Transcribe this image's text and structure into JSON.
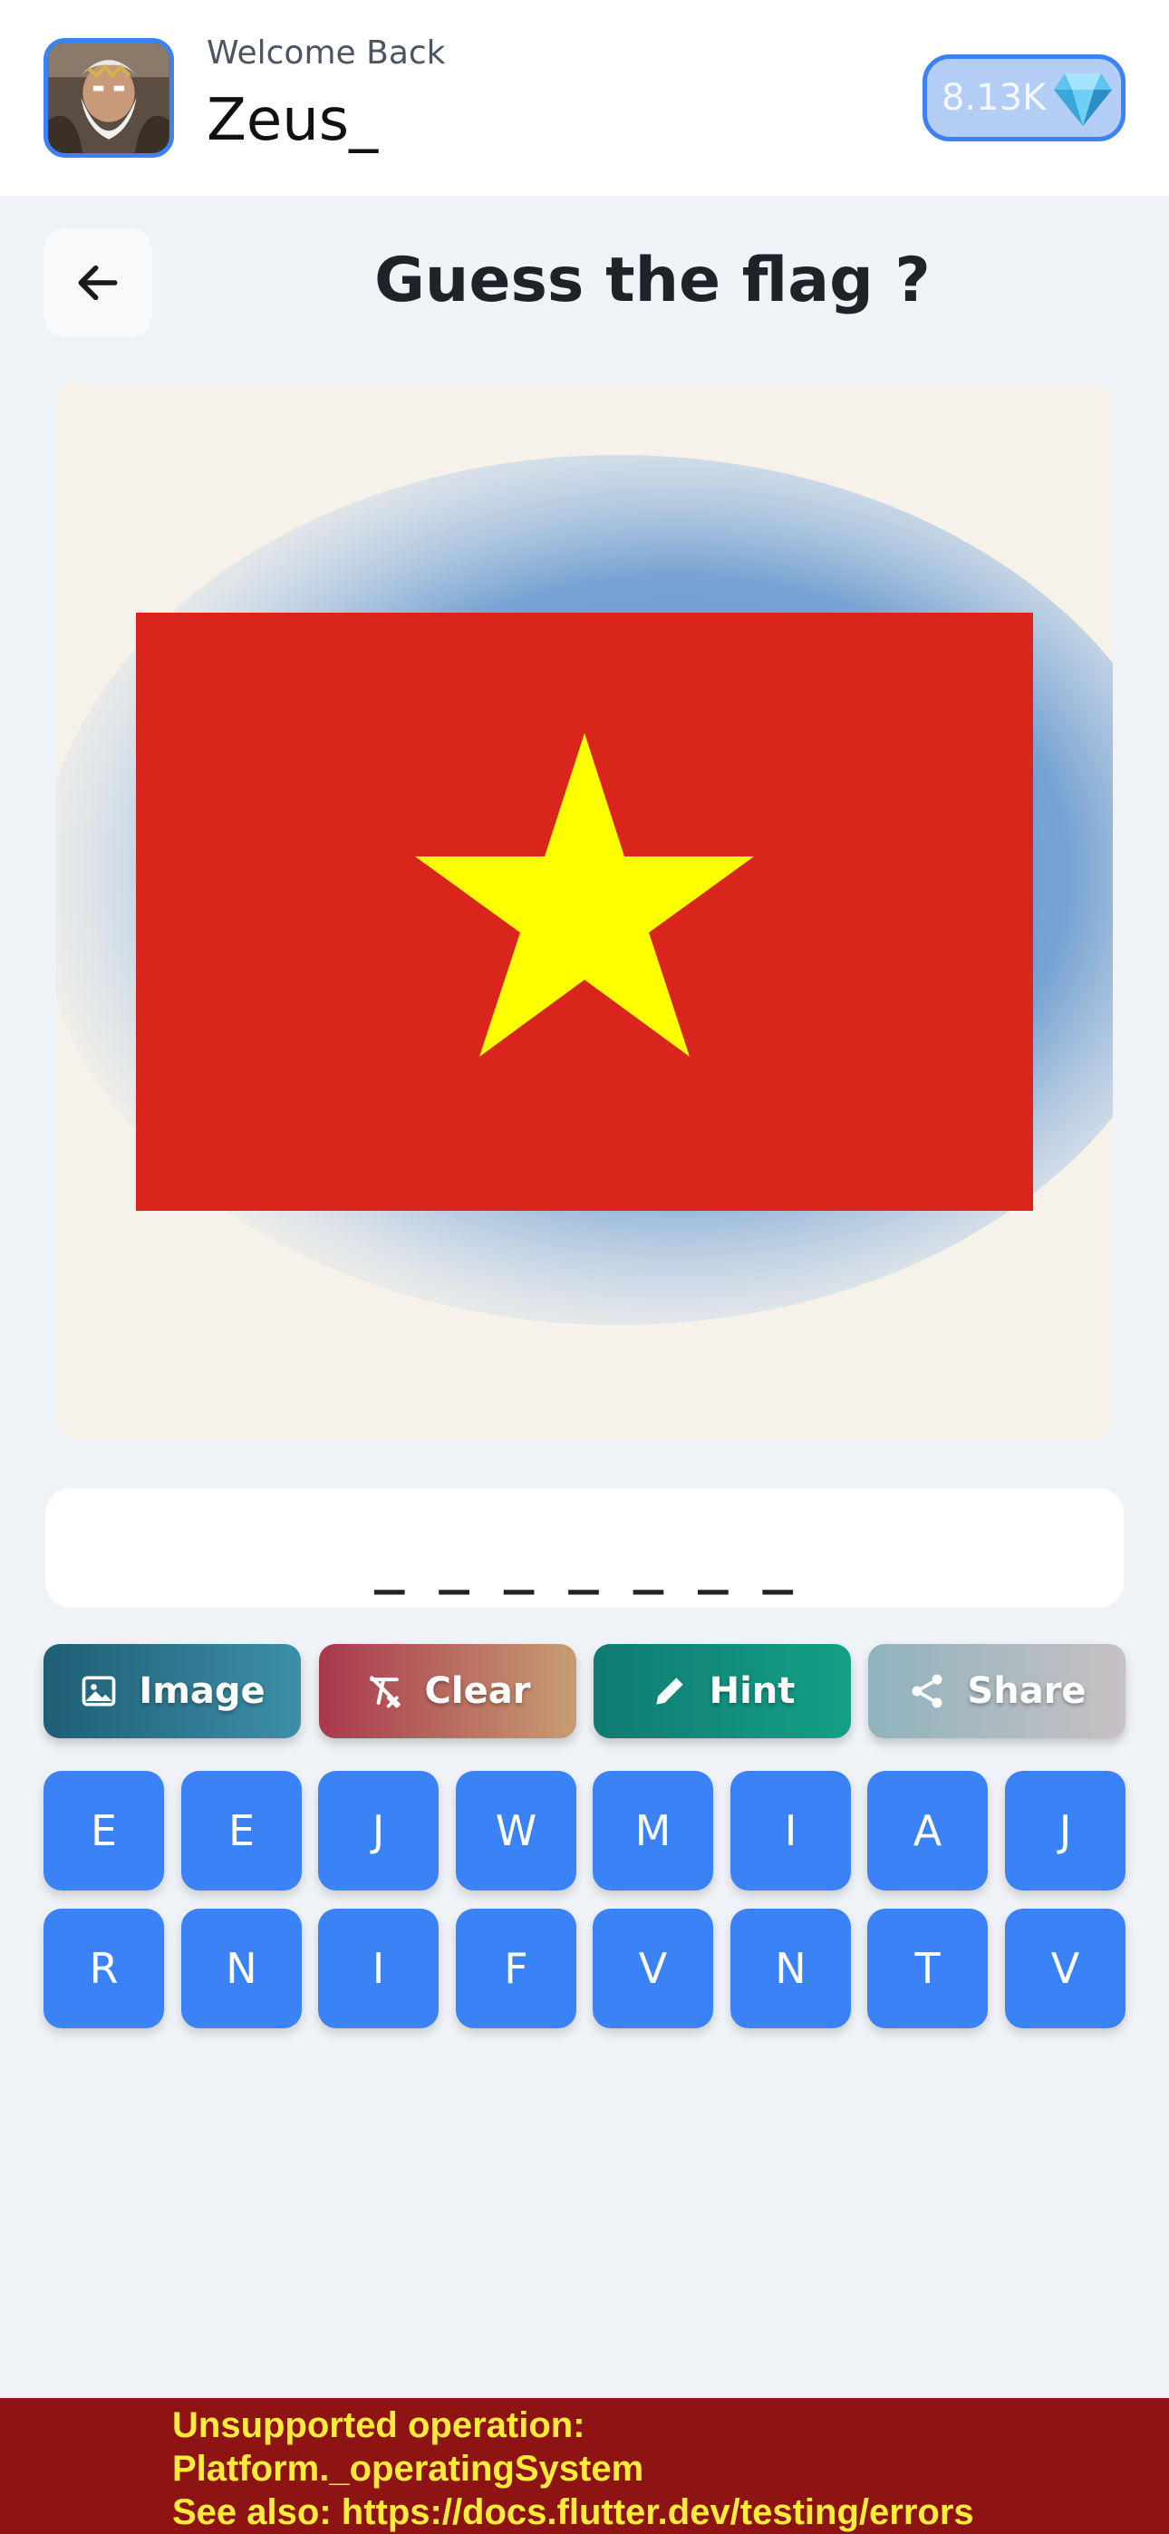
{
  "header": {
    "welcome": "Welcome Back",
    "username": "Zeus_",
    "gems": "8.13K",
    "gem_icon": "diamond-gem-icon",
    "avatar_icon": "zeus-avatar-image"
  },
  "page": {
    "title": "Guess the flag ?",
    "back_icon": "arrow-left-icon"
  },
  "flag": {
    "field_color": "#da251d",
    "star_color": "#ffff00"
  },
  "answer": {
    "display": "_ _ _ _ _ _ _"
  },
  "actions": [
    {
      "label": "Image",
      "icon": "image-icon"
    },
    {
      "label": "Clear",
      "icon": "clear-format-icon"
    },
    {
      "label": "Hint",
      "icon": "pencil-icon"
    },
    {
      "label": "Share",
      "icon": "share-icon"
    }
  ],
  "keys": {
    "row1": [
      "E",
      "E",
      "J",
      "W",
      "M",
      "I",
      "A",
      "J"
    ],
    "row2": [
      "R",
      "N",
      "I",
      "F",
      "V",
      "N",
      "T",
      "V"
    ]
  },
  "error": {
    "lines": [
      "Unsupported operation:",
      "Platform._operatingSystem",
      "See also: https://docs.flutter.dev/testing/errors"
    ]
  },
  "colors": {
    "accent": "#3b82f6",
    "background": "#eff2f7",
    "error_bg": "#8e1414",
    "error_text": "#ffeb3b"
  }
}
